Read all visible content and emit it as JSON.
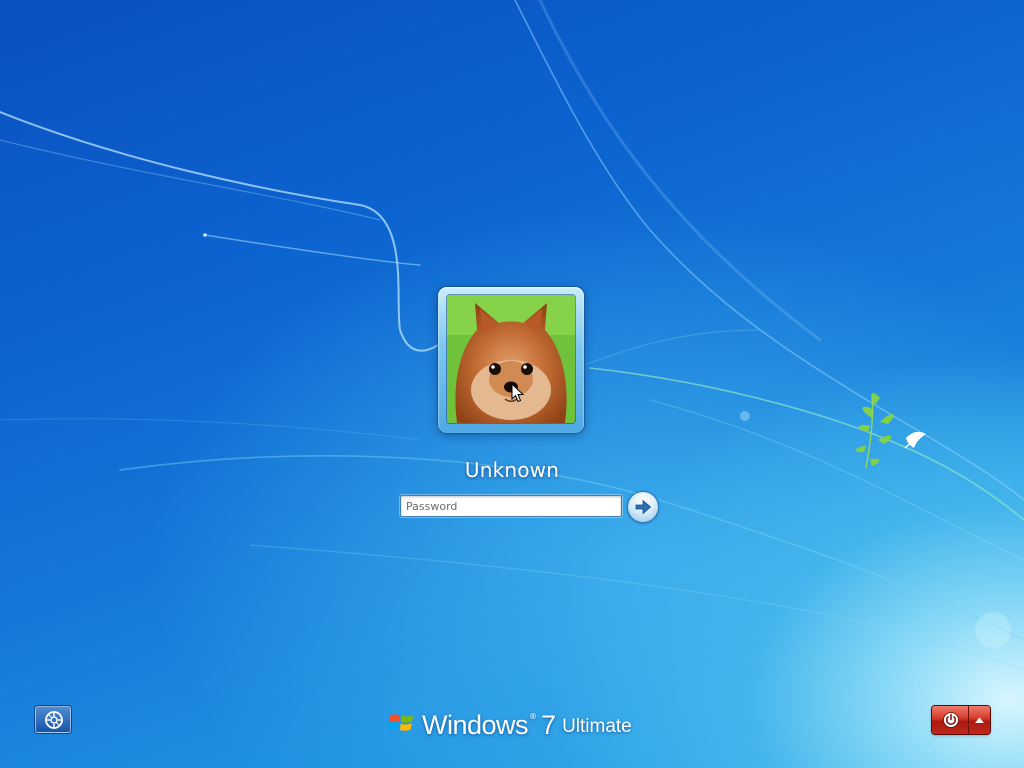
{
  "login": {
    "user_name": "Unknown",
    "user_picture": "pomeranian-dog-photo",
    "password_placeholder": "Password",
    "password_value": "",
    "submit_icon": "arrow-right-icon"
  },
  "footer": {
    "ease_of_access_icon": "ease-of-access-icon",
    "brand_name": "Windows",
    "brand_version": "7",
    "brand_edition": "Ultimate",
    "shutdown_icon": "power-icon",
    "shutdown_options_icon": "triangle-up-icon"
  },
  "colors": {
    "background_dark": "#0a4fbf",
    "background_light": "#8fdcf7",
    "shutdown_red": "#d43a2a",
    "tile_frame": "#7fc8ef"
  }
}
